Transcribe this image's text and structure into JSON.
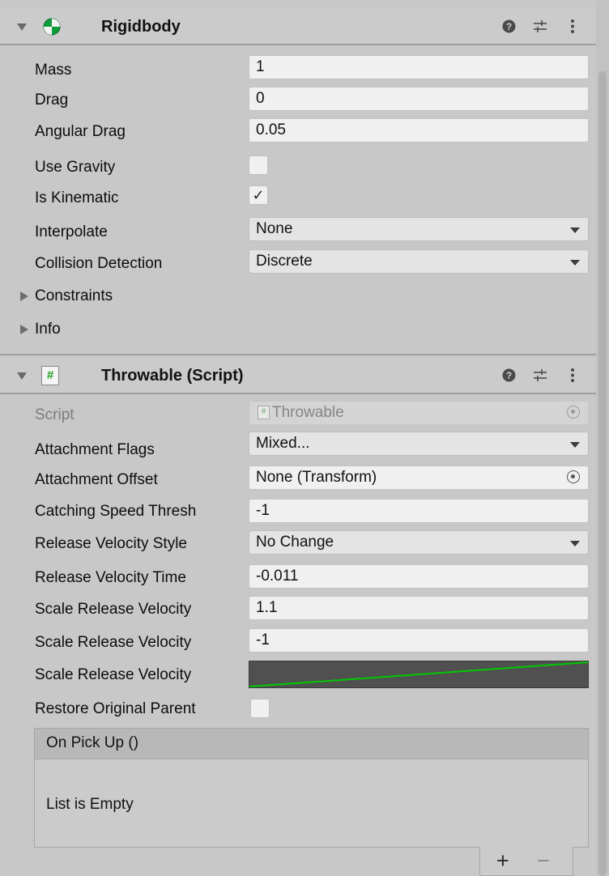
{
  "rigidbody": {
    "title": "Rigidbody",
    "fields": {
      "mass": {
        "label": "Mass",
        "value": "1"
      },
      "drag": {
        "label": "Drag",
        "value": "0"
      },
      "angular_drag": {
        "label": "Angular Drag",
        "value": "0.05"
      },
      "use_gravity": {
        "label": "Use Gravity",
        "checked": false
      },
      "is_kinematic": {
        "label": "Is Kinematic",
        "checked": true,
        "mark": "✓"
      },
      "interpolate": {
        "label": "Interpolate",
        "value": "None"
      },
      "collision_detection": {
        "label": "Collision Detection",
        "value": "Discrete"
      }
    },
    "foldouts": {
      "constraints": "Constraints",
      "info": "Info"
    }
  },
  "throwable": {
    "title": "Throwable (Script)",
    "icon_glyph": "#",
    "fields": {
      "script": {
        "label": "Script",
        "value": "Throwable",
        "icon_glyph": "#"
      },
      "attachment_flags": {
        "label": "Attachment Flags",
        "value": "Mixed..."
      },
      "attachment_offset": {
        "label": "Attachment Offset",
        "value": "None (Transform)"
      },
      "catching_speed": {
        "label": "Catching Speed Thresh",
        "value": "-1"
      },
      "release_velocity_style": {
        "label": "Release Velocity Style",
        "value": "No Change"
      },
      "release_velocity_time": {
        "label": "Release Velocity Time",
        "value": "-0.011"
      },
      "scale_release_velocity_1": {
        "label": "Scale Release Velocity",
        "value": "1.1"
      },
      "scale_release_velocity_2": {
        "label": "Scale Release Velocity",
        "value": "-1"
      },
      "scale_release_velocity_curve": {
        "label": "Scale Release Velocity",
        "curve_color": "#00c800"
      },
      "restore_original_parent": {
        "label": "Restore Original Parent",
        "checked": false
      }
    },
    "on_pick_up": {
      "header": "On Pick Up ()",
      "empty_text": "List is Empty",
      "add_label": "+",
      "remove_label": "−"
    }
  },
  "icons": {
    "help": "?",
    "preset": "⇄",
    "menu": "⋮",
    "checkmark": "✓"
  },
  "colors": {
    "panel": "#c8c8c8",
    "curve_bg": "#505050",
    "curve_line": "#00c800",
    "rigidbody_icon_green": "#0f9d3a"
  }
}
